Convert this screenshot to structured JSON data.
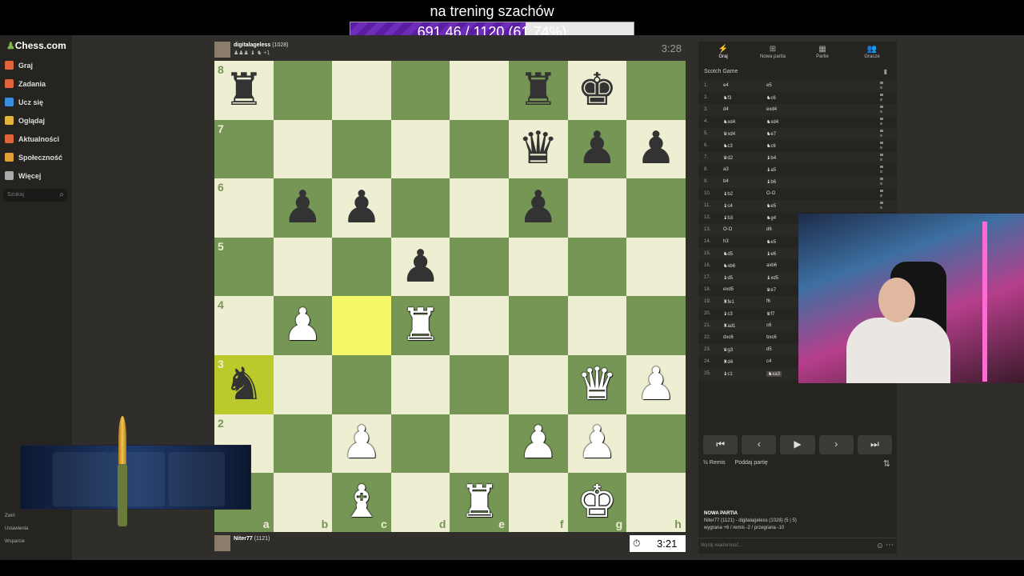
{
  "overlay": {
    "title": "na trening szachów",
    "goal_text": "691.46 / 1120 (61.74%)",
    "goal_fraction": 0.6174,
    "goal_color": "#6d2dba"
  },
  "sidebar": {
    "brand": "Chess.com",
    "items": [
      {
        "label": "Graj",
        "icon": "play-icon",
        "color": "#e2643a"
      },
      {
        "label": "Zadania",
        "icon": "puzzle-icon",
        "color": "#e2643a"
      },
      {
        "label": "Ucz się",
        "icon": "learn-icon",
        "color": "#3a8ee2"
      },
      {
        "label": "Oglądaj",
        "icon": "watch-icon",
        "color": "#e2b43a"
      },
      {
        "label": "Aktualności",
        "icon": "news-icon",
        "color": "#e2643a"
      },
      {
        "label": "Społeczność",
        "icon": "community-icon",
        "color": "#e2a03a"
      },
      {
        "label": "Więcej",
        "icon": "more-icon",
        "color": "#aaaaaa"
      }
    ],
    "search_placeholder": "Szukaj",
    "footer": [
      "Zwiń",
      "Ustawienia",
      "Wsparcie"
    ]
  },
  "top_player": {
    "name": "digitalageless",
    "rating": "(1028)",
    "material": "♟♟♟ ♝ ♞ +1"
  },
  "bottom_player": {
    "name": "Niter77",
    "rating": "(1121)"
  },
  "clocks": {
    "top": "3:28",
    "bottom": "3:21"
  },
  "board": {
    "ranks": [
      "8",
      "7",
      "6",
      "5",
      "4",
      "3",
      "2",
      "1"
    ],
    "files": [
      "a",
      "b",
      "c",
      "d",
      "e",
      "f",
      "g",
      "h"
    ],
    "position": [
      [
        "r",
        "",
        "",
        "",
        "",
        "r",
        "k",
        ""
      ],
      [
        "",
        "",
        "",
        "",
        "",
        "q",
        "p",
        "p"
      ],
      [
        "",
        "p",
        "p",
        "",
        "",
        "p",
        "",
        ""
      ],
      [
        "",
        "",
        "",
        "p",
        "",
        "",
        "",
        ""
      ],
      [
        "",
        "P",
        "",
        "R",
        "",
        "",
        "",
        ""
      ],
      [
        "n",
        "",
        "",
        "",
        "",
        "",
        "Q",
        "P"
      ],
      [
        "",
        "",
        "P",
        "",
        "",
        "P",
        "P",
        ""
      ],
      [
        "",
        "",
        "B",
        "",
        "R",
        "",
        "K",
        ""
      ]
    ],
    "highlights": [
      "c4",
      "a3"
    ]
  },
  "panel": {
    "tabs": [
      "Graj",
      "Nowa partia",
      "Partie",
      "Gracze"
    ],
    "opening": "Scotch Game",
    "moves": [
      [
        "1.",
        "e4",
        "e5"
      ],
      [
        "2.",
        "♞f3",
        "♞c6"
      ],
      [
        "3.",
        "d4",
        "exd4"
      ],
      [
        "4.",
        "♞xd4",
        "♞xd4"
      ],
      [
        "5.",
        "♛xd4",
        "♞e7"
      ],
      [
        "6.",
        "♞c3",
        "♞c6"
      ],
      [
        "7.",
        "♛d2",
        "♝b4"
      ],
      [
        "8.",
        "a3",
        "♝a5"
      ],
      [
        "9.",
        "b4",
        "♝b6"
      ],
      [
        "10.",
        "♝b2",
        "O-O"
      ],
      [
        "11.",
        "♝c4",
        "♞e5"
      ],
      [
        "12.",
        "♝b3",
        "♞g4"
      ],
      [
        "13.",
        "O-O",
        "d6"
      ],
      [
        "14.",
        "h3",
        "♞e5"
      ],
      [
        "15.",
        "♞d5",
        "♝e6"
      ],
      [
        "16.",
        "♞xb6",
        "axb6"
      ],
      [
        "17.",
        "♝d5",
        "♝xd5"
      ],
      [
        "18.",
        "exd5",
        "♛e7"
      ],
      [
        "19.",
        "♜fe1",
        "f6"
      ],
      [
        "20.",
        "♝c3",
        "♛f7"
      ],
      [
        "21.",
        "♜ad1",
        "c6"
      ],
      [
        "22.",
        "dxc6",
        "bxc6"
      ],
      [
        "23.",
        "♛g3",
        "d5"
      ],
      [
        "24.",
        "♜d4",
        "c4"
      ],
      [
        "25.",
        "♝c1",
        "♞xa3"
      ]
    ],
    "actions": [
      "½ Remis",
      "Poddaj partię"
    ],
    "new_game_title": "NOWA PARTIA",
    "new_game_line1": "Niter77 (1121) - digitalageless (1028) (5 | 5)",
    "new_game_line2": "wygrana +6 / remis -2 / przegrana -10",
    "chat_placeholder": "Wyślij wiadomość..."
  }
}
